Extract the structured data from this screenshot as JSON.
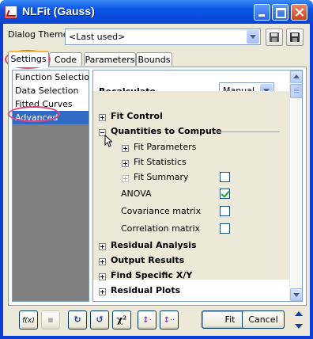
{
  "window": {
    "title": "NLFit (Gauss)"
  },
  "theme": {
    "label": "Dialog Theme",
    "value": "<Last used>"
  },
  "tabs": [
    {
      "label": "Settings"
    },
    {
      "label": "Code"
    },
    {
      "label": "Parameters"
    },
    {
      "label": "Bounds"
    }
  ],
  "left_list": {
    "items": [
      "Function Selection",
      "Data Selection",
      "Fitted Curves",
      "Advanced"
    ],
    "selected": "Advanced"
  },
  "settings": {
    "recalculate": {
      "label": "Recalculate",
      "value": "Manual"
    },
    "fit_control": "Fit Control",
    "quantities": "Quantities to Compute",
    "fit_parameters": "Fit Parameters",
    "fit_statistics": "Fit Statistics",
    "fit_summary": "Fit Summary",
    "anova": "ANOVA",
    "covariance": "Covariance matrix",
    "correlation": "Correlation matrix",
    "residual_analysis": "Residual Analysis",
    "output_results": "Output Results",
    "find_specific": "Find Specific X/Y",
    "residual_plots": "Residual Plots"
  },
  "checks": {
    "fit_summary": false,
    "anova": true,
    "covariance": false,
    "correlation": false
  },
  "bottom": {
    "chi2": "χ²",
    "fit": "Fit",
    "cancel": "Cancel"
  },
  "colors": {
    "titlebar": "#0a55e6",
    "selection": "#316ac5",
    "highlight": "#e0457a"
  }
}
